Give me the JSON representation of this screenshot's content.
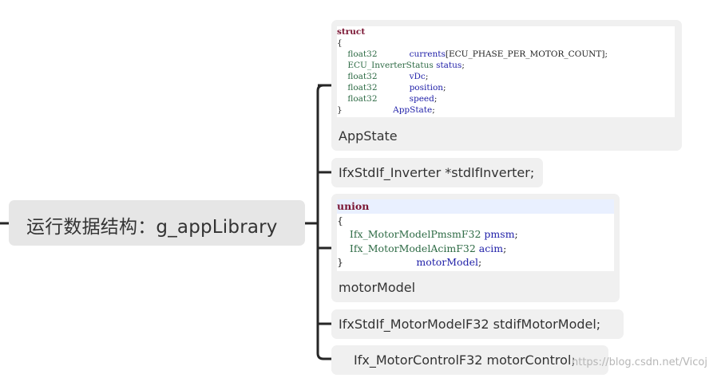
{
  "root": {
    "label": "运行数据结构：g_appLibrary"
  },
  "branches": [
    {
      "label": "AppState",
      "code": [
        [
          {
            "t": "kw",
            "s": "struct"
          }
        ],
        [
          {
            "t": "plain",
            "s": "{"
          }
        ],
        [
          {
            "t": "ty",
            "s": "    float32            "
          },
          {
            "t": "fld",
            "s": "currents"
          },
          {
            "t": "plain",
            "s": "[ECU_PHASE_PER_MOTOR_COUNT];"
          }
        ],
        [
          {
            "t": "ty",
            "s": "    ECU_InverterStatus "
          },
          {
            "t": "fld",
            "s": "status"
          },
          {
            "t": "plain",
            "s": ";"
          }
        ],
        [
          {
            "t": "ty",
            "s": "    float32            "
          },
          {
            "t": "fld",
            "s": "vDc"
          },
          {
            "t": "plain",
            "s": ";"
          }
        ],
        [
          {
            "t": "ty",
            "s": "    float32            "
          },
          {
            "t": "fld",
            "s": "position"
          },
          {
            "t": "plain",
            "s": ";"
          }
        ],
        [
          {
            "t": "ty",
            "s": "    float32            "
          },
          {
            "t": "fld",
            "s": "speed"
          },
          {
            "t": "plain",
            "s": ";"
          }
        ],
        [
          {
            "t": "plain",
            "s": "}                   "
          },
          {
            "t": "fld",
            "s": "AppState"
          },
          {
            "t": "plain",
            "s": ";"
          }
        ]
      ]
    },
    {
      "label": "IfxStdIf_Inverter *stdIfInverter;"
    },
    {
      "label": "motorModel",
      "code": [
        [
          {
            "t": "kw",
            "s": "union"
          }
        ],
        [
          {
            "t": "plain",
            "s": "{"
          }
        ],
        [
          {
            "t": "ty",
            "s": "    Ifx_MotorModelPmsmF32 "
          },
          {
            "t": "fld",
            "s": "pmsm"
          },
          {
            "t": "plain",
            "s": ";"
          }
        ],
        [
          {
            "t": "ty",
            "s": "    Ifx_MotorModelAcimF32 "
          },
          {
            "t": "fld",
            "s": "acim"
          },
          {
            "t": "plain",
            "s": ";"
          }
        ],
        [
          {
            "t": "plain",
            "s": "}                       "
          },
          {
            "t": "fld",
            "s": "motorModel"
          },
          {
            "t": "plain",
            "s": ";"
          }
        ]
      ]
    },
    {
      "label": "IfxStdIf_MotorModelF32 stdifMotorModel;"
    },
    {
      "label": "Ifx_MotorControlF32    motorControl;"
    }
  ],
  "watermark": "https://blog.csdn.net/Vicoj",
  "colors": {
    "connector": "#262626",
    "node_bg": "#f0f0f0",
    "root_bg": "#e6e6e6",
    "keyword": "#7a1533",
    "type": "#2e6b45",
    "field": "#1f1fa8"
  }
}
